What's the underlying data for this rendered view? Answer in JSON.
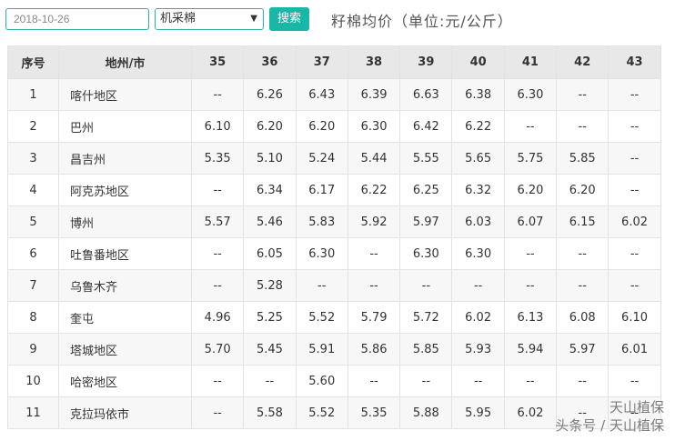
{
  "toolbar": {
    "date_value": "2018-10-26",
    "select_value": "机采棉",
    "search_label": "搜索",
    "title": "籽棉均价（单位:元/公斤）"
  },
  "table": {
    "headers": [
      "序号",
      "地州/市",
      "35",
      "36",
      "37",
      "38",
      "39",
      "40",
      "41",
      "42",
      "43"
    ],
    "rows": [
      [
        "1",
        "喀什地区",
        "--",
        "6.26",
        "6.43",
        "6.39",
        "6.63",
        "6.38",
        "6.30",
        "--",
        "--"
      ],
      [
        "2",
        "巴州",
        "6.10",
        "6.20",
        "6.20",
        "6.30",
        "6.42",
        "6.22",
        "--",
        "--",
        "--"
      ],
      [
        "3",
        "昌吉州",
        "5.35",
        "5.10",
        "5.24",
        "5.44",
        "5.55",
        "5.65",
        "5.75",
        "5.85",
        "--"
      ],
      [
        "4",
        "阿克苏地区",
        "--",
        "6.34",
        "6.17",
        "6.22",
        "6.25",
        "6.32",
        "6.20",
        "6.20",
        "--"
      ],
      [
        "5",
        "博州",
        "5.57",
        "5.46",
        "5.83",
        "5.92",
        "5.97",
        "6.03",
        "6.07",
        "6.15",
        "6.02"
      ],
      [
        "6",
        "吐鲁番地区",
        "--",
        "6.05",
        "6.30",
        "--",
        "6.30",
        "6.30",
        "--",
        "--",
        "--"
      ],
      [
        "7",
        "乌鲁木齐",
        "--",
        "5.28",
        "--",
        "--",
        "--",
        "--",
        "--",
        "--",
        "--"
      ],
      [
        "8",
        "奎屯",
        "4.96",
        "5.25",
        "5.52",
        "5.79",
        "5.72",
        "6.02",
        "6.13",
        "6.08",
        "6.10"
      ],
      [
        "9",
        "塔城地区",
        "5.70",
        "5.45",
        "5.91",
        "5.86",
        "5.85",
        "5.93",
        "5.94",
        "5.97",
        "6.01"
      ],
      [
        "10",
        "哈密地区",
        "--",
        "--",
        "5.60",
        "--",
        "--",
        "--",
        "--",
        "--",
        "--"
      ],
      [
        "11",
        "克拉玛依市",
        "--",
        "5.58",
        "5.52",
        "5.35",
        "5.88",
        "5.95",
        "6.02",
        "--",
        "--"
      ]
    ]
  },
  "watermark": {
    "line1": "天山植保",
    "line2": "头条号 / 天山植保"
  }
}
